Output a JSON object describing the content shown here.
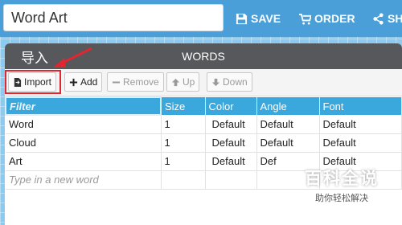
{
  "header": {
    "title_value": "Word Art",
    "save_label": "SAVE",
    "order_label": "ORDER",
    "share_label": "SHA"
  },
  "panel": {
    "title": "WORDS",
    "annotation": "导入"
  },
  "toolbar": {
    "import_label": "Import",
    "add_label": "Add",
    "remove_label": "Remove",
    "up_label": "Up",
    "down_label": "Down"
  },
  "table": {
    "columns": [
      "Filter",
      "Size",
      "Color",
      "Angle",
      "Font"
    ],
    "rows": [
      [
        "Word",
        "1",
        "Default",
        "Default",
        "Default"
      ],
      [
        "Cloud",
        "1",
        "Default",
        "Default",
        "Default"
      ],
      [
        "Art",
        "1",
        "Default",
        "Def",
        "Default"
      ]
    ],
    "new_word_placeholder": "Type in a new word"
  },
  "watermark": {
    "main": "百科全说",
    "sub": "助你轻松解决"
  },
  "colors": {
    "topbar": "#4a9fd8",
    "panel_header": "#56585c",
    "table_header": "#3aa8dd",
    "highlight": "#e0262f"
  },
  "icons": {
    "save": "floppy-icon",
    "order": "cart-icon",
    "share": "share-icon",
    "import": "file-import-icon",
    "add": "plus-icon",
    "remove": "minus-icon",
    "up": "arrow-up-icon",
    "down": "arrow-down-icon"
  }
}
